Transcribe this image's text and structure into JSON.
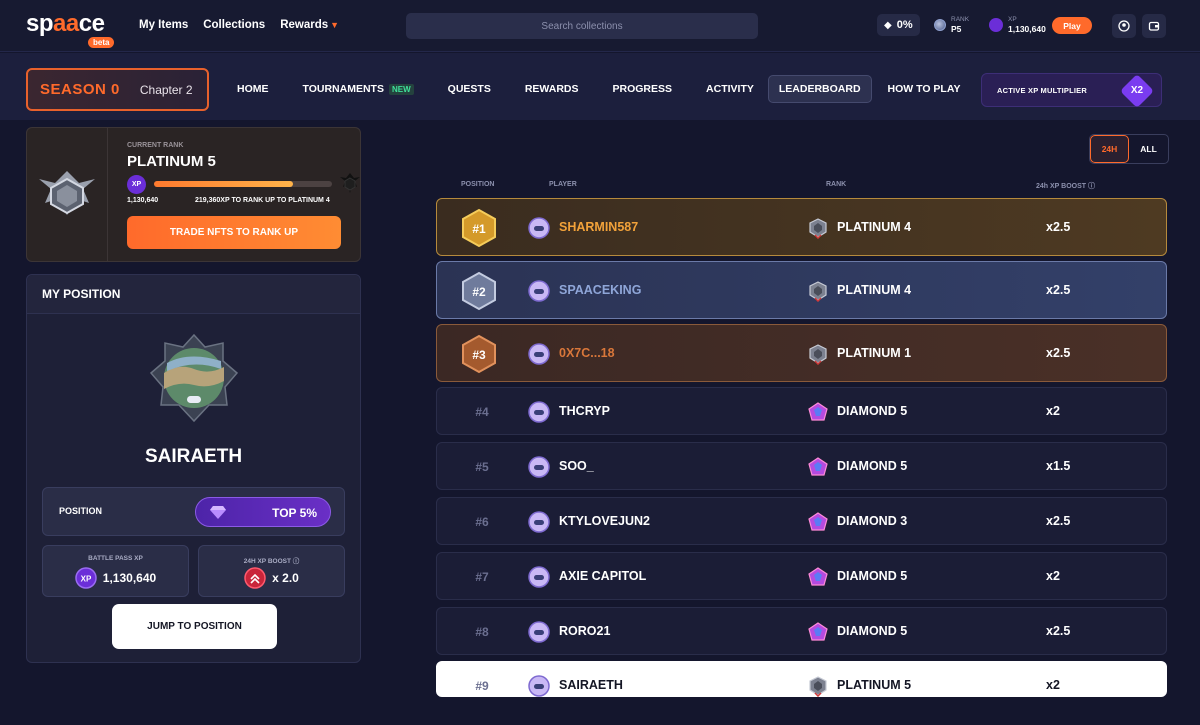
{
  "header": {
    "logo_text": "spaace",
    "beta_label": "beta",
    "nav": [
      "My Items",
      "Collections",
      "Rewards"
    ],
    "search_placeholder": "Search collections",
    "percent_stat": "0%",
    "rank_label": "RANK",
    "rank_value": "P5",
    "xp_label": "XP",
    "xp_value": "1,130,640",
    "play_label": "Play"
  },
  "season": {
    "title": "SEASON 0",
    "chapter": "Chapter 2",
    "tabs": [
      {
        "label": "HOME"
      },
      {
        "label": "TOURNAMENTS",
        "badge": "NEW"
      },
      {
        "label": "QUESTS"
      },
      {
        "label": "REWARDS"
      },
      {
        "label": "PROGRESS"
      },
      {
        "label": "ACTIVITY"
      },
      {
        "label": "LEADERBOARD",
        "active": true
      },
      {
        "label": "HOW TO PLAY"
      }
    ],
    "multiplier_label": "ACTIVE XP MULTIPLIER",
    "multiplier_value": "X2"
  },
  "rank_card": {
    "label": "CURRENT RANK",
    "rank": "PLATINUM 5",
    "xp_chip": "XP",
    "progress_fraction": 0.78,
    "xp_current": "1,130,640",
    "xp_to_next": "219,360XP TO RANK UP TO PLATINUM 4",
    "button": "TRADE NFTS TO RANK UP"
  },
  "my_position": {
    "title": "MY POSITION",
    "player": "SAIRAETH",
    "position_label": "POSITION",
    "position_value": "TOP 5%",
    "bp_label": "BATTLE PASS XP",
    "bp_value": "1,130,640",
    "boost_label": "24H XP BOOST",
    "boost_value": "x 2.0",
    "jump_button": "JUMP TO POSITION"
  },
  "leaderboard": {
    "toggle": [
      "24H",
      "ALL"
    ],
    "toggle_active": "24H",
    "headers": {
      "position": "POSITION",
      "player": "PLAYER",
      "rank": "RANK",
      "boost": "24h XP BOOST"
    },
    "rows": [
      {
        "pos": "#1",
        "player": "SHARMIN587",
        "rank": "PLATINUM 4",
        "boost": "x2.5",
        "style": "gold",
        "player_color": "#f2a23a"
      },
      {
        "pos": "#2",
        "player": "SPAACEKING",
        "rank": "PLATINUM 4",
        "boost": "x2.5",
        "style": "silver",
        "player_color": "#8fa6d8"
      },
      {
        "pos": "#3",
        "player": "0X7C...18",
        "rank": "PLATINUM 1",
        "boost": "x2.5",
        "style": "bronze",
        "player_color": "#d9773a"
      },
      {
        "pos": "#4",
        "player": "THCRYP",
        "rank": "DIAMOND 5",
        "boost": "x2",
        "style": "plain"
      },
      {
        "pos": "#5",
        "player": "SOO_",
        "rank": "DIAMOND 5",
        "boost": "x1.5",
        "style": "plain"
      },
      {
        "pos": "#6",
        "player": "KTYLOVEJUN2",
        "rank": "DIAMOND 3",
        "boost": "x2.5",
        "style": "plain"
      },
      {
        "pos": "#7",
        "player": "AXIE CAPITOL",
        "rank": "DIAMOND 5",
        "boost": "x2",
        "style": "plain"
      },
      {
        "pos": "#8",
        "player": "RORO21",
        "rank": "DIAMOND 5",
        "boost": "x2.5",
        "style": "plain"
      },
      {
        "pos": "#9",
        "player": "SAIRAETH",
        "rank": "PLATINUM 5",
        "boost": "x2",
        "style": "me"
      }
    ]
  },
  "colors": {
    "accent": "#ff6a2b",
    "purple": "#6b2ed8",
    "bg": "#14162d"
  }
}
